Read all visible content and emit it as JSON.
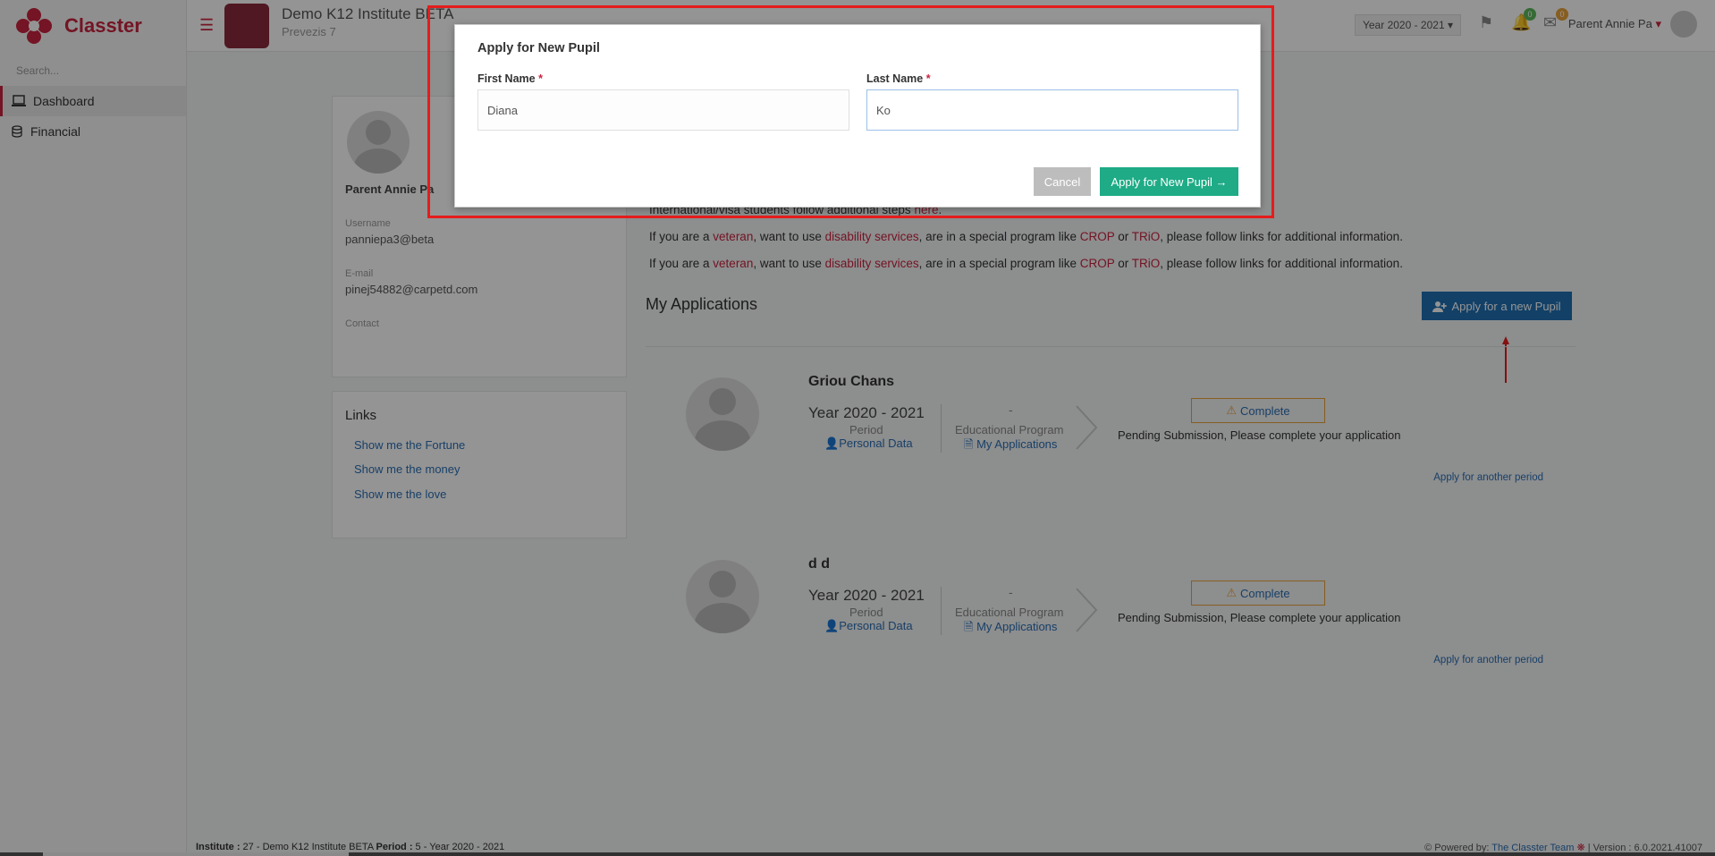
{
  "sidebar": {
    "brand": "Classter",
    "search_placeholder": "Search...",
    "items": [
      {
        "label": "Dashboard",
        "active": true
      },
      {
        "label": "Financial",
        "active": false
      }
    ]
  },
  "topbar": {
    "institute_name": "Demo K12 Institute BETA",
    "institute_sub": "Prevezis 7",
    "year_select": "Year 2020 - 2021",
    "flag_icon": "flag-icon",
    "bell_badge": "0",
    "mail_badge": "0",
    "user_name": "Parent Annie Pa"
  },
  "profile": {
    "name": "Parent Annie Pa",
    "username_label": "Username",
    "username_value": "panniepa3@beta",
    "email_label": "E-mail",
    "email_value": "pinej54882@carpetd.com",
    "contact_label": "Contact"
  },
  "links": {
    "title": "Links",
    "items": [
      "Show me the Fortune",
      "Show me the money",
      "Show me the love"
    ]
  },
  "info": {
    "line1_prefix": "International/visa students follow additional steps ",
    "line1_link": "here",
    "line1_suffix": ".",
    "line_prefix": "If you are a ",
    "veteran": "veteran",
    "mid1": ", want to use ",
    "disability": "disability services",
    "mid2": ", are in a special program like ",
    "crop": "CROP",
    "or": " or ",
    "trio": "TRiO",
    "suffix": ", please follow links for additional information."
  },
  "applications": {
    "title": "My Applications",
    "apply_button": "Apply for a new Pupil",
    "entries": [
      {
        "name": "Griou Chans",
        "year": "Year 2020 - 2021",
        "period_label": "Period",
        "personal_data": "Personal Data",
        "dash": "-",
        "edu_label": "Educational Program",
        "my_applications": "My Applications",
        "status": "Complete",
        "pending": "Pending Submission, Please complete your application",
        "another_period": "Apply for another period"
      },
      {
        "name": "d d",
        "year": "Year 2020 - 2021",
        "period_label": "Period",
        "personal_data": "Personal Data",
        "dash": "-",
        "edu_label": "Educational Program",
        "my_applications": "My Applications",
        "status": "Complete",
        "pending": "Pending Submission, Please complete your application",
        "another_period": "Apply for another period"
      }
    ]
  },
  "footer": {
    "institute_label": "Institute :",
    "institute_value": " 27 - Demo K12 Institute BETA ",
    "period_label": "Period :",
    "period_value": " 5 - Year 2020 - 2021",
    "powered_by": "Powered by: ",
    "team": "The Classter Team",
    "version": "| Version : 6.0.2021.41007"
  },
  "modal": {
    "title": "Apply for New Pupil",
    "first_name_label": "First Name",
    "first_name_value": "Diana",
    "last_name_label": "Last Name",
    "last_name_value": "Ko",
    "required_mark": "*",
    "cancel": "Cancel",
    "apply": "Apply for New Pupil →"
  },
  "colors": {
    "brand": "#c9243f",
    "primary_button": "#1f6fb2",
    "apply_green": "#1eab86",
    "highlight_red": "#e51c1c",
    "warning": "#e8a23a"
  }
}
